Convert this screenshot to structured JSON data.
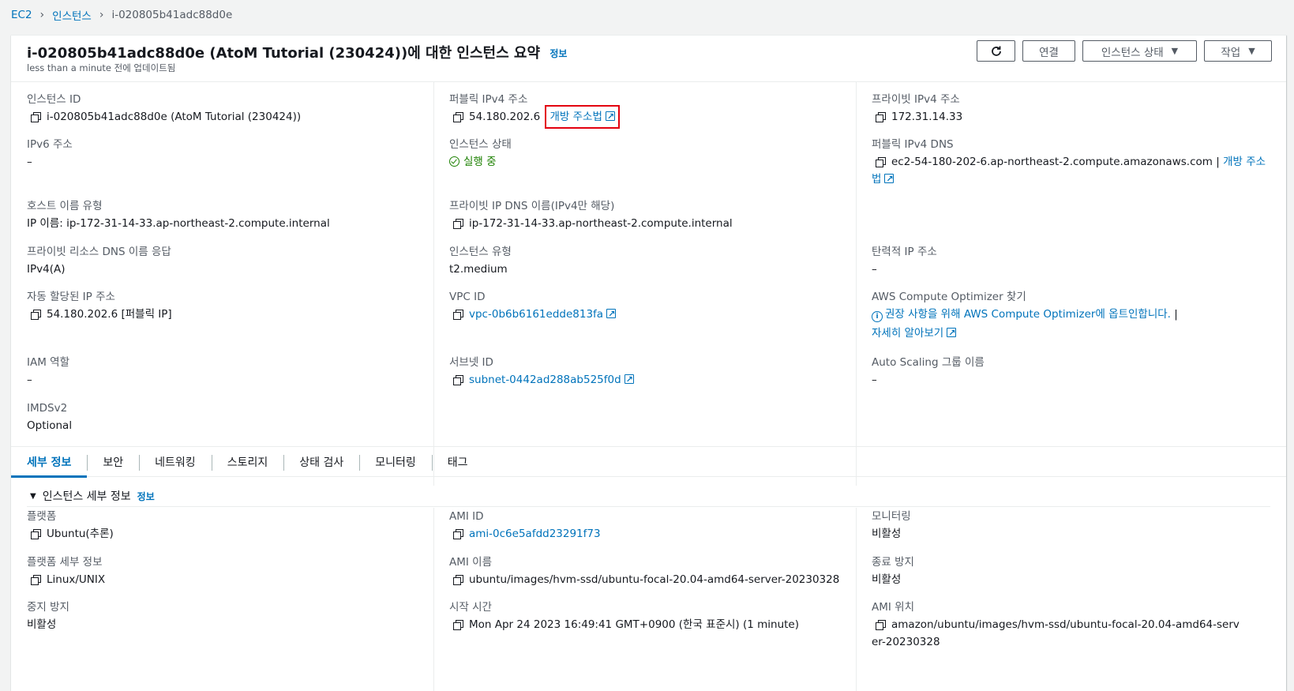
{
  "breadcrumb": {
    "root": "EC2",
    "section": "인스턴스",
    "current": "i-020805b41adc88d0e"
  },
  "header": {
    "title": "i-020805b41adc88d0e (AtoM Tutorial (230424))에 대한 인스턴스 요약",
    "info_label": "정보",
    "updated": "less than a minute 전에 업데이트됨",
    "connect_label": "연결",
    "instance_state_label": "인스턴스 상태",
    "actions_label": "작업"
  },
  "summary": {
    "instance_id": {
      "label": "인스턴스 ID",
      "value": "i-020805b41adc88d0e (AtoM Tutorial (230424))"
    },
    "public_ipv4": {
      "label": "퍼블릭 IPv4 주소",
      "value": "54.180.202.6",
      "link": "개방 주소법"
    },
    "private_ipv4": {
      "label": "프라이빗 IPv4 주소",
      "value": "172.31.14.33"
    },
    "ipv6": {
      "label": "IPv6 주소",
      "value": "–"
    },
    "instance_state": {
      "label": "인스턴스 상태",
      "value": "실행 중"
    },
    "public_dns": {
      "label": "퍼블릭 IPv4 DNS",
      "value": "ec2-54-180-202-6.ap-northeast-2.compute.amazonaws.com",
      "separator": "|",
      "link_a": "개방 주소",
      "link_b": "법"
    },
    "hostname_type": {
      "label": "호스트 이름 유형",
      "value": "IP 이름: ip-172-31-14-33.ap-northeast-2.compute.internal"
    },
    "private_dns": {
      "label": "프라이빗 IP DNS 이름(IPv4만 해당)",
      "value": "ip-172-31-14-33.ap-northeast-2.compute.internal"
    },
    "resource_dns": {
      "label": "프라이빗 리소스 DNS 이름 응답",
      "value": "IPv4(A)"
    },
    "instance_type": {
      "label": "인스턴스 유형",
      "value": "t2.medium"
    },
    "elastic_ip": {
      "label": "탄력적 IP 주소",
      "value": "–"
    },
    "auto_ip": {
      "label": "자동 할당된 IP 주소",
      "value": "54.180.202.6 [퍼블릭 IP]"
    },
    "vpc_id": {
      "label": "VPC ID",
      "value": "vpc-0b6b6161edde813fa"
    },
    "optimizer": {
      "label": "AWS Compute Optimizer 찾기",
      "value": "권장 사항을 위해 AWS Compute Optimizer에 옵트인합니다.",
      "separator": "|",
      "learn_more": "자세히 알아보기"
    },
    "iam_role": {
      "label": "IAM 역할",
      "value": "–"
    },
    "subnet_id": {
      "label": "서브넷 ID",
      "value": "subnet-0442ad288ab525f0d"
    },
    "asg_name": {
      "label": "Auto Scaling 그룹 이름",
      "value": "–"
    },
    "imdsv2": {
      "label": "IMDSv2",
      "value": "Optional"
    }
  },
  "tabs": [
    "세부 정보",
    "보안",
    "네트워킹",
    "스토리지",
    "상태 검사",
    "모니터링",
    "태그"
  ],
  "details": {
    "section_title": "인스턴스 세부 정보",
    "info_label": "정보",
    "platform": {
      "label": "플랫폼",
      "value": "Ubuntu(추론)"
    },
    "ami_id": {
      "label": "AMI ID",
      "value": "ami-0c6e5afdd23291f73"
    },
    "monitoring": {
      "label": "모니터링",
      "value": "비활성"
    },
    "platform_details": {
      "label": "플랫폼 세부 정보",
      "value": "Linux/UNIX"
    },
    "ami_name": {
      "label": "AMI 이름",
      "value": "ubuntu/images/hvm-ssd/ubuntu-focal-20.04-amd64-server-20230328"
    },
    "termination_protection": {
      "label": "종료 방지",
      "value": "비활성"
    },
    "stop_protection": {
      "label": "중지 방지",
      "value": "비활성"
    },
    "launch_time": {
      "label": "시작 시간",
      "value": "Mon Apr 24 2023 16:49:41 GMT+0900 (한국 표준시) (1 minute)"
    },
    "ami_location": {
      "label": "AMI 위치",
      "value": "amazon/ubuntu/images/hvm-ssd/ubuntu-focal-20.04-amd64-server-20230328"
    }
  },
  "colors": {
    "link": "#0073bb",
    "success": "#1d8102",
    "highlight": "#e3000f"
  }
}
